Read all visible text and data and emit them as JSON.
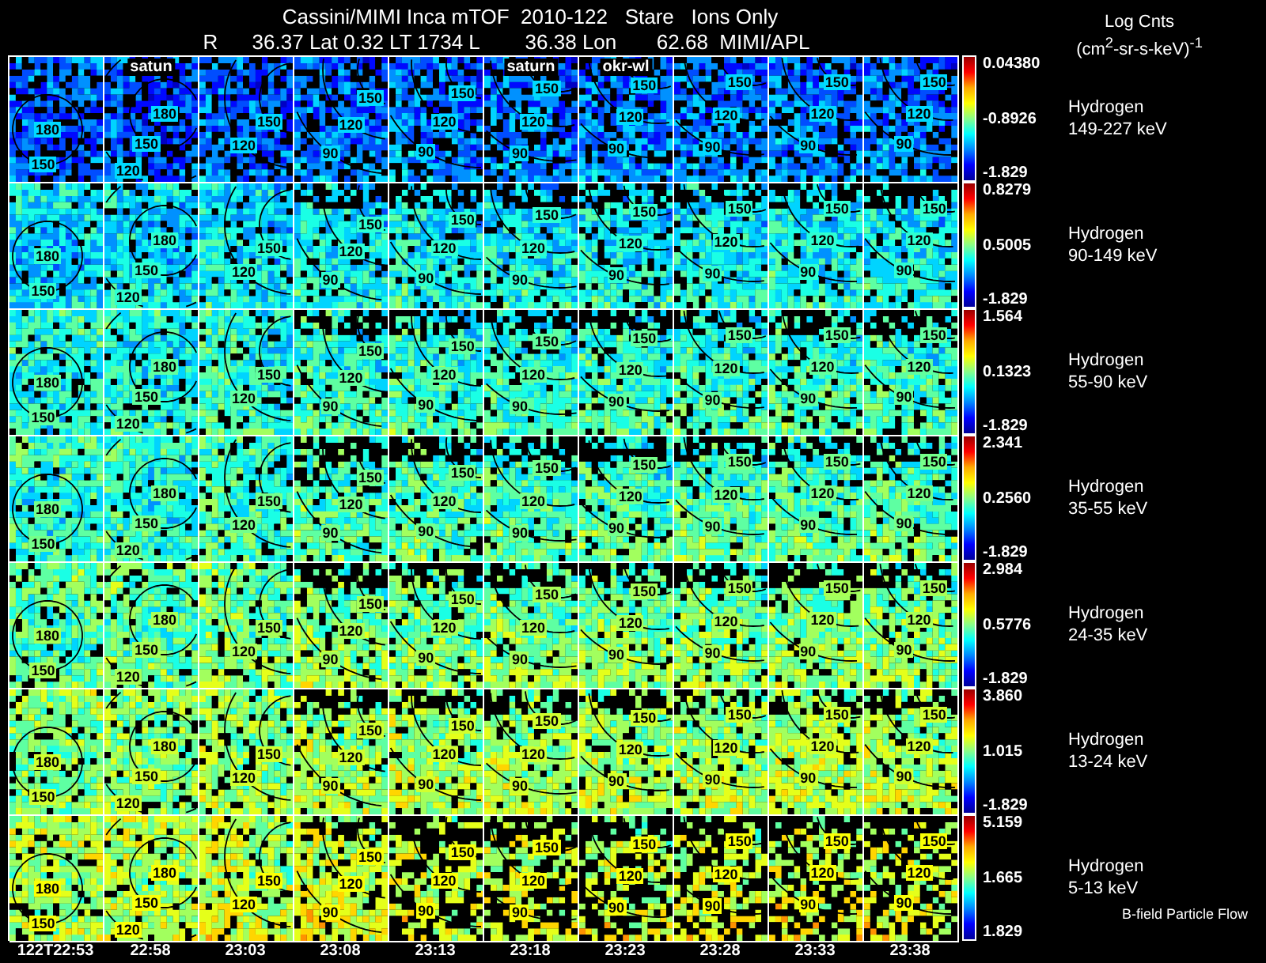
{
  "title": {
    "line1": "Cassini/MIMI Inca mTOF  2010-122   Stare   Ions Only",
    "line2": "R      36.37 Lat 0.32 LT 1734 L        36.38 Lon       62.68  MIMI/APL"
  },
  "units": {
    "name": "Log Cnts",
    "unit": "(cm$^{2}$-sr-s-keV)$^{-1}$"
  },
  "rows": [
    {
      "species": "Hydrogen",
      "energy": "149-227 keV",
      "scale": {
        "max": "0.04380",
        "mid": "-0.8926",
        "min": "-1.829"
      },
      "panels": [
        {
          "contours": [
            "180",
            "150"
          ]
        },
        {
          "contours": [
            "180",
            "150",
            "120"
          ],
          "marker": "satun"
        },
        {
          "contours": [
            "150",
            "120"
          ]
        },
        {
          "contours": [
            "150",
            "120",
            "90"
          ]
        },
        {
          "contours": [
            "150",
            "120",
            "90"
          ]
        },
        {
          "contours": [
            "150",
            "120",
            "90"
          ],
          "marker": "saturn"
        },
        {
          "contours": [
            "150",
            "120",
            "90"
          ],
          "marker": "okr-wl"
        },
        {
          "contours": [
            "150",
            "120",
            "90"
          ]
        },
        {
          "contours": [
            "150",
            "120",
            "90"
          ]
        },
        {
          "contours": [
            "150",
            "120",
            "90"
          ]
        }
      ]
    },
    {
      "species": "Hydrogen",
      "energy": "90-149 keV",
      "scale": {
        "max": "0.8279",
        "mid": "0.5005",
        "min": "-1.829"
      },
      "panels": [
        {
          "contours": [
            "180",
            "150"
          ]
        },
        {
          "contours": [
            "180",
            "150",
            "120"
          ]
        },
        {
          "contours": [
            "150",
            "120"
          ]
        },
        {
          "contours": [
            "150",
            "120",
            "90"
          ]
        },
        {
          "contours": [
            "150",
            "120",
            "90"
          ]
        },
        {
          "contours": [
            "150",
            "120",
            "90"
          ]
        },
        {
          "contours": [
            "150",
            "120",
            "90"
          ]
        },
        {
          "contours": [
            "150",
            "120",
            "90"
          ]
        },
        {
          "contours": [
            "150",
            "120",
            "90"
          ]
        },
        {
          "contours": [
            "150",
            "120",
            "90"
          ]
        }
      ]
    },
    {
      "species": "Hydrogen",
      "energy": "55-90 keV",
      "scale": {
        "max": "1.564",
        "mid": "0.1323",
        "min": "-1.829"
      },
      "panels": [
        {
          "contours": [
            "180",
            "150"
          ]
        },
        {
          "contours": [
            "180",
            "150",
            "120"
          ]
        },
        {
          "contours": [
            "150",
            "120"
          ]
        },
        {
          "contours": [
            "150",
            "120",
            "90"
          ]
        },
        {
          "contours": [
            "150",
            "120",
            "90"
          ]
        },
        {
          "contours": [
            "150",
            "120",
            "90"
          ]
        },
        {
          "contours": [
            "150",
            "120",
            "90"
          ]
        },
        {
          "contours": [
            "150",
            "120",
            "90"
          ]
        },
        {
          "contours": [
            "150",
            "120",
            "90"
          ]
        },
        {
          "contours": [
            "150",
            "120",
            "90"
          ]
        }
      ]
    },
    {
      "species": "Hydrogen",
      "energy": "35-55 keV",
      "scale": {
        "max": "2.341",
        "mid": "0.2560",
        "min": "-1.829"
      },
      "panels": [
        {
          "contours": [
            "180",
            "150"
          ]
        },
        {
          "contours": [
            "180",
            "150",
            "120"
          ]
        },
        {
          "contours": [
            "150",
            "120"
          ]
        },
        {
          "contours": [
            "150",
            "120",
            "90"
          ]
        },
        {
          "contours": [
            "150",
            "120",
            "90"
          ]
        },
        {
          "contours": [
            "150",
            "120",
            "90"
          ]
        },
        {
          "contours": [
            "150",
            "120",
            "90"
          ]
        },
        {
          "contours": [
            "150",
            "120",
            "90"
          ]
        },
        {
          "contours": [
            "150",
            "120",
            "90"
          ]
        },
        {
          "contours": [
            "150",
            "120",
            "90"
          ]
        }
      ]
    },
    {
      "species": "Hydrogen",
      "energy": "24-35 keV",
      "scale": {
        "max": "2.984",
        "mid": "0.5776",
        "min": "-1.829"
      },
      "panels": [
        {
          "contours": [
            "180",
            "150"
          ]
        },
        {
          "contours": [
            "180",
            "150",
            "120"
          ]
        },
        {
          "contours": [
            "150",
            "120"
          ]
        },
        {
          "contours": [
            "150",
            "120",
            "90"
          ]
        },
        {
          "contours": [
            "150",
            "120",
            "90"
          ]
        },
        {
          "contours": [
            "150",
            "120",
            "90"
          ]
        },
        {
          "contours": [
            "150",
            "120",
            "90"
          ]
        },
        {
          "contours": [
            "150",
            "120",
            "90"
          ]
        },
        {
          "contours": [
            "150",
            "120",
            "90"
          ]
        },
        {
          "contours": [
            "150",
            "120",
            "90"
          ]
        }
      ]
    },
    {
      "species": "Hydrogen",
      "energy": "13-24 keV",
      "scale": {
        "max": "3.860",
        "mid": "1.015",
        "min": "-1.829"
      },
      "panels": [
        {
          "contours": [
            "180",
            "150"
          ]
        },
        {
          "contours": [
            "180",
            "150",
            "120"
          ]
        },
        {
          "contours": [
            "150",
            "120"
          ]
        },
        {
          "contours": [
            "150",
            "120",
            "90"
          ]
        },
        {
          "contours": [
            "150",
            "120",
            "90"
          ]
        },
        {
          "contours": [
            "150",
            "120",
            "90"
          ]
        },
        {
          "contours": [
            "150",
            "120",
            "90"
          ]
        },
        {
          "contours": [
            "150",
            "120",
            "90"
          ]
        },
        {
          "contours": [
            "150",
            "120",
            "90"
          ]
        },
        {
          "contours": [
            "150",
            "120",
            "90"
          ]
        }
      ]
    },
    {
      "species": "Hydrogen",
      "energy": "5-13 keV",
      "scale": {
        "max": "5.159",
        "mid": "1.665",
        "min": "1.829"
      },
      "note": "B-field Particle Flow",
      "panels": [
        {
          "contours": [
            "180",
            "150"
          ]
        },
        {
          "contours": [
            "180",
            "150",
            "120"
          ]
        },
        {
          "contours": [
            "150",
            "120"
          ]
        },
        {
          "contours": [
            "150",
            "120",
            "90"
          ]
        },
        {
          "contours": [
            "150",
            "120",
            "90"
          ]
        },
        {
          "contours": [
            "150",
            "120",
            "90"
          ]
        },
        {
          "contours": [
            "150",
            "120",
            "90"
          ]
        },
        {
          "contours": [
            "150",
            "120",
            "90"
          ]
        },
        {
          "contours": [
            "150",
            "120",
            "90"
          ]
        },
        {
          "contours": [
            "150",
            "120",
            "90"
          ]
        }
      ]
    }
  ],
  "time_labels": [
    "122T22:53",
    "22:58",
    "23:03",
    "23:08",
    "23:13",
    "23:18",
    "23:23",
    "23:28",
    "23:33",
    "23:38"
  ]
}
